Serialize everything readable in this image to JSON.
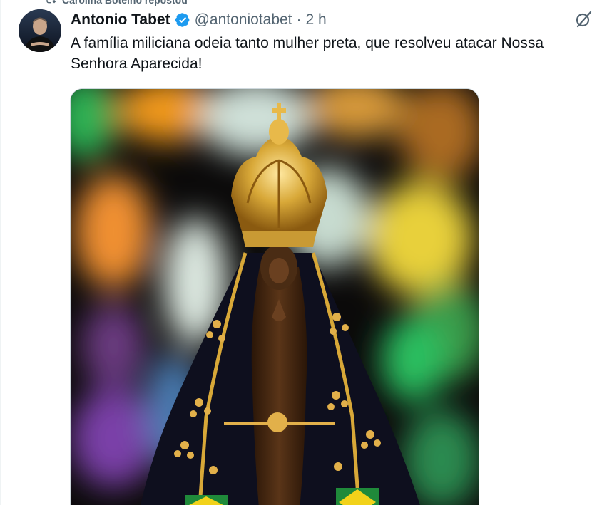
{
  "repost": {
    "text": "Carolina Botelho repostou"
  },
  "tweet": {
    "author_name": "Antonio Tabet",
    "handle": "@antoniotabet",
    "separator": "·",
    "time": "2 h",
    "text": "A família miliciana odeia tanto mulher preta, que resolveu atacar Nossa Senhora Aparecida!"
  },
  "icons": {
    "verified": "verified-badge-icon",
    "grok": "grok-icon",
    "repost": "repost-icon"
  },
  "colors": {
    "verified_blue": "#1d9bf0",
    "secondary_text": "#536471",
    "primary_text": "#0f1419"
  }
}
